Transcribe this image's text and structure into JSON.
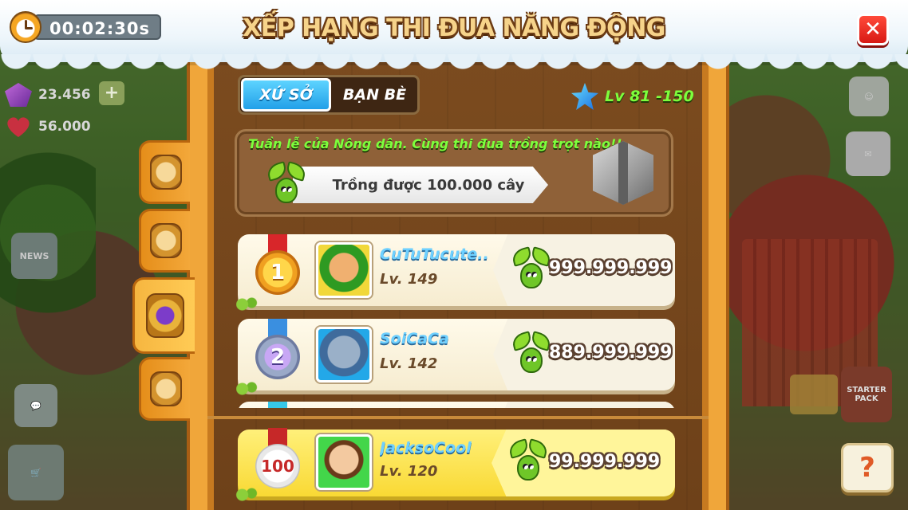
{
  "timer": {
    "text": "00:02:30s"
  },
  "title": "XẾP HẠNG THI ĐUA NĂNG ĐỘNG",
  "close_icon": "close-icon",
  "background": {
    "gems": "23.456",
    "hearts": "56.000",
    "news_label": "NEWS",
    "starter_label": "STARTER PACK"
  },
  "tabs": [
    {
      "label": "XỨ SỞ",
      "active": true
    },
    {
      "label": "BẠN BÈ",
      "active": false
    }
  ],
  "level_range": "Lv 81 -150",
  "quest": {
    "description": "Tuần lễ của Nông dân. Cùng thi đua trồng trọt nào!!",
    "goal": "Trồng được 100.000 cây",
    "reward_icon": "silver-chest-icon"
  },
  "rankings": [
    {
      "rank": "1",
      "name": "CuTuTucute....",
      "level": "Lv. 149",
      "score": "999.999.999",
      "medal": "gold"
    },
    {
      "rank": "2",
      "name": "SoiCaCa",
      "level": "Lv. 142",
      "score": "889.999.999",
      "medal": "silver"
    },
    {
      "rank": "",
      "name": "",
      "level": "",
      "score": "",
      "medal": "cyan"
    }
  ],
  "my_rank": {
    "rank": "100",
    "name": "JacksoCool",
    "level": "Lv. 120",
    "score": "99.999.999"
  },
  "help_label": "?",
  "colors": {
    "accent_green": "#7dff3c",
    "tab_blue": "#22a0e8",
    "panel_wood": "#7b4b1f",
    "frame_orange": "#f0a63a",
    "my_row_yellow": "#f9d934"
  }
}
